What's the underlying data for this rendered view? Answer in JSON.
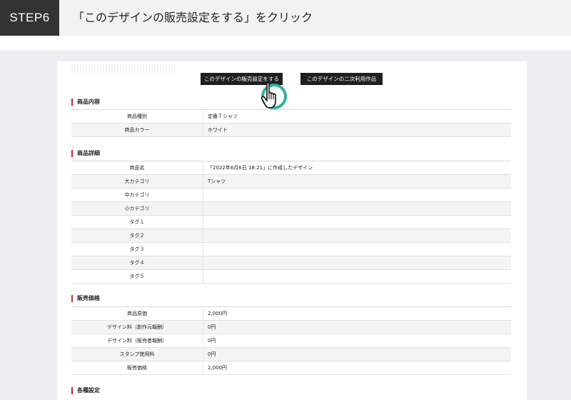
{
  "header": {
    "step": "STEP6",
    "title": "「このデザインの販売設定をする」をクリック"
  },
  "buttons": {
    "sale_setting": "このデザインの販売設定をする",
    "derivative_works": "このデザインの二次利用作品"
  },
  "icons": {
    "pointer": "hand-pointer-icon",
    "accent_color": "#2fb39a"
  },
  "sections": [
    {
      "title": "商品内容",
      "rows": [
        {
          "label": "商品種別",
          "value": "定番Ｔシャツ"
        },
        {
          "label": "商品カラー",
          "value": "ホワイト"
        }
      ]
    },
    {
      "title": "商品詳細",
      "rows": [
        {
          "label": "商品名",
          "value": "「2022年6月6日 18:21」に作成したデザイン"
        },
        {
          "label": "大カテゴリ",
          "value": "Tシャツ"
        },
        {
          "label": "中カテゴリ",
          "value": ""
        },
        {
          "label": "小カテゴリ",
          "value": ""
        },
        {
          "label": "タグ１",
          "value": ""
        },
        {
          "label": "タグ２",
          "value": ""
        },
        {
          "label": "タグ３",
          "value": ""
        },
        {
          "label": "タグ４",
          "value": ""
        },
        {
          "label": "タグ５",
          "value": ""
        }
      ]
    },
    {
      "title": "販売価格",
      "rows": [
        {
          "label": "商品原価",
          "value": "2,000円"
        },
        {
          "label": "デザイン料（創作元報酬）",
          "value": "0円"
        },
        {
          "label": "デザイン料（販売者報酬）",
          "value": "0円"
        },
        {
          "label": "スタンプ使用料",
          "value": "0円"
        },
        {
          "label": "販売価格",
          "value": "2,000円"
        }
      ]
    },
    {
      "title": "各種設定",
      "rows": []
    }
  ]
}
